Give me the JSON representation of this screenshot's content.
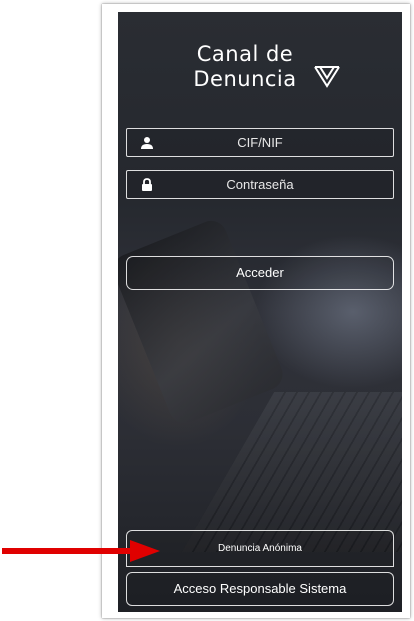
{
  "logo": {
    "line1": "Canal de",
    "line2": "Denuncia",
    "mark_icon": "v-logo-icon"
  },
  "form": {
    "username": {
      "placeholder": "CIF/NIF",
      "icon": "user-icon"
    },
    "password": {
      "placeholder": "Contraseña",
      "icon": "lock-icon"
    },
    "submit_label": "Acceder"
  },
  "footer": {
    "anonymous_label": "Denuncia Anónima",
    "responsible_label": "Acceso Responsable Sistema"
  },
  "annotation": {
    "icon": "red-arrow-icon",
    "color": "#e00000"
  },
  "colors": {
    "text": "#ffffff",
    "background": "#2a2d33",
    "border": "#ffffff"
  }
}
